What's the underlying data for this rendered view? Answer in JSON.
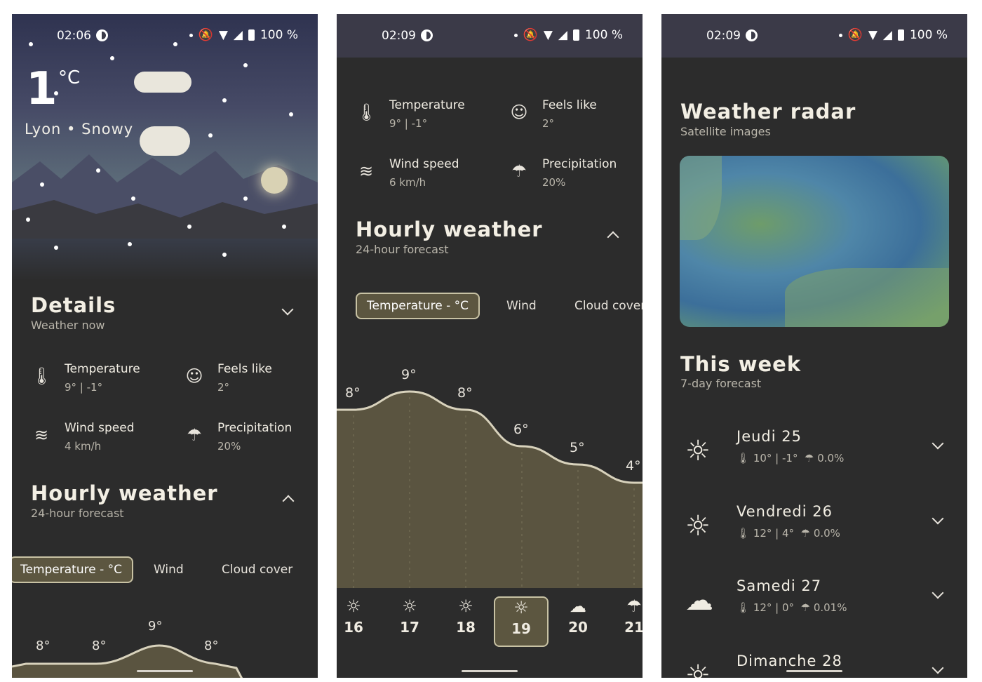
{
  "status": [
    {
      "time": "02:06",
      "battery": "100 %"
    },
    {
      "time": "02:09",
      "battery": "100 %"
    },
    {
      "time": "02:09",
      "battery": "100 %"
    }
  ],
  "current": {
    "temp": "1",
    "unit": "°C",
    "location": "Lyon",
    "condition": "Snowy"
  },
  "details": {
    "title": "Details",
    "subtitle": "Weather now",
    "items": [
      {
        "label": "Temperature",
        "value": "9° | -1°",
        "icon": "thermometer-icon"
      },
      {
        "label": "Feels like",
        "value": "2°",
        "icon": "face-icon"
      },
      {
        "label": "Wind speed",
        "value": "4 km/h",
        "icon": "wind-icon"
      },
      {
        "label": "Precipitation",
        "value": "20%",
        "icon": "umbrella-icon"
      }
    ],
    "wind_p2": "6 km/h"
  },
  "hourly": {
    "title": "Hourly weather",
    "subtitle": "24-hour forecast",
    "tabs": [
      "Temperature - °C",
      "Wind",
      "Cloud cover"
    ],
    "chart_p1_labels": [
      "8°",
      "8°",
      "9°",
      "8°",
      "6°"
    ],
    "hours": [
      "16",
      "17",
      "18",
      "19",
      "20",
      "21"
    ],
    "hour_icons": [
      "sun-icon",
      "sun-icon",
      "sun-icon",
      "sun-icon",
      "cloud-fog-icon",
      "rain-icon"
    ]
  },
  "chart_data": {
    "type": "area",
    "x": [
      "16",
      "17",
      "18",
      "19",
      "20",
      "21"
    ],
    "values": [
      8,
      9,
      8,
      6,
      5,
      4
    ],
    "labels": [
      "8°",
      "9°",
      "8°",
      "6°",
      "5°",
      "4°"
    ],
    "ylabel": "",
    "xlabel": ""
  },
  "radar": {
    "title": "Weather radar",
    "subtitle": "Satellite images"
  },
  "week": {
    "title": "This week",
    "subtitle": "7-day forecast",
    "days": [
      {
        "name": "Jeudi 25",
        "temps": "10° | -1°",
        "precip": "0.0%",
        "icon": "sun-icon"
      },
      {
        "name": "Vendredi 26",
        "temps": "12° | 4°",
        "precip": "0.0%",
        "icon": "sun-icon"
      },
      {
        "name": "Samedi 27",
        "temps": "12° | 0°",
        "precip": "0.01%",
        "icon": "cloud-icon"
      },
      {
        "name": "Dimanche 28",
        "temps": "",
        "precip": "",
        "icon": "sun-icon"
      }
    ]
  }
}
